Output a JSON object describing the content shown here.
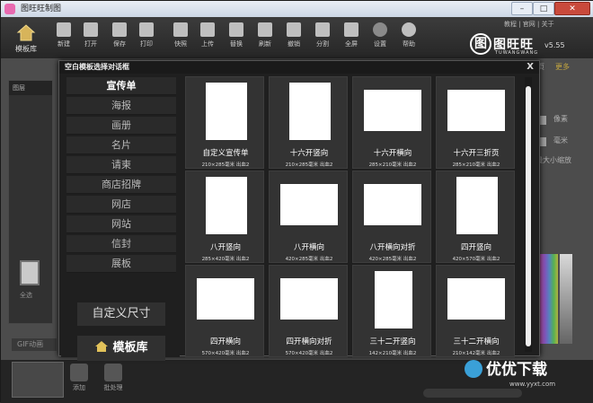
{
  "window": {
    "title": "图旺旺制图"
  },
  "toolbar": {
    "home_label": "模板库",
    "buttons": [
      "新建",
      "打开",
      "保存",
      "打印",
      "快照",
      "上传",
      "替换",
      "刷新",
      "撤销",
      "分割",
      "全屏",
      "设置",
      "帮助"
    ],
    "links": "教程 | 官网 | 关于",
    "logo_name": "图旺旺",
    "logo_sub": "TUWANGWANG",
    "version": "v5.55"
  },
  "background": {
    "layers_label": "图层",
    "all_label": "全选",
    "gif_label": "GIF动画",
    "add_label": "添加",
    "batch_label": "批处理",
    "right_labels": [
      "像素",
      "毫米",
      "最大小缩放"
    ],
    "misc_label": "入页",
    "more_label": "更多"
  },
  "dialog": {
    "title": "空白模板选择对话框",
    "close": "X",
    "categories": [
      "宣传单",
      "海报",
      "画册",
      "名片",
      "请柬",
      "商店招牌",
      "网店",
      "网站",
      "信封",
      "展板"
    ],
    "active_category": "宣传单",
    "custom_size": "自定义尺寸",
    "template_lib": "模板库",
    "templates": [
      {
        "name": "自定义宣传单",
        "size": "210×285毫米  出血2"
      },
      {
        "name": "十六开竖向",
        "size": "210×285毫米  出血2"
      },
      {
        "name": "十六开横向",
        "size": "285×210毫米  出血2"
      },
      {
        "name": "十六开三折页",
        "size": "285×210毫米  出血2"
      },
      {
        "name": "八开竖向",
        "size": "285×420毫米  出血2"
      },
      {
        "name": "八开横向",
        "size": "420×285毫米  出血2"
      },
      {
        "name": "八开横向对折",
        "size": "420×285毫米  出血2"
      },
      {
        "name": "四开竖向",
        "size": "420×570毫米  出血2"
      },
      {
        "name": "四开横向",
        "size": "570×420毫米  出血2"
      },
      {
        "name": "四开横向对折",
        "size": "570×420毫米  出血2"
      },
      {
        "name": "三十二开竖向",
        "size": "142×210毫米  出血2"
      },
      {
        "name": "三十二开横向",
        "size": "210×142毫米  出血2"
      }
    ]
  },
  "watermark": {
    "text": "优优下载",
    "url": "www.yyxt.com"
  }
}
